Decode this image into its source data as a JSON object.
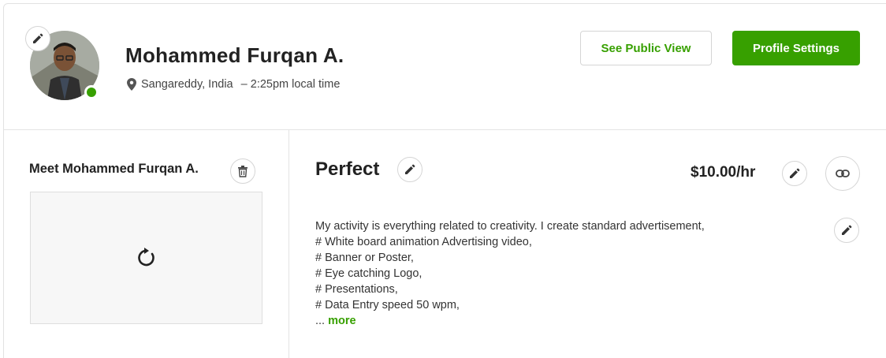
{
  "profile": {
    "name": "Mohammed Furqan A.",
    "location": "Sangareddy, India",
    "separator": " – ",
    "local_time": "2:25pm local time",
    "status": "online"
  },
  "actions": {
    "public_view_label": "See Public View",
    "settings_label": "Profile Settings"
  },
  "video": {
    "title": "Meet Mohammed Furqan A."
  },
  "overview": {
    "title": "Perfect",
    "rate": "$10.00/hr",
    "lines": [
      "My activity is everything related to creativity. I create standard advertisement,",
      "# White board animation Advertising video,",
      "# Banner or Poster,",
      "# Eye catching Logo,",
      "# Presentations,",
      "# Data Entry speed 50 wpm,"
    ],
    "ellipsis": "...",
    "more_label": "more"
  },
  "colors": {
    "accent": "#37a000",
    "border": "#e4e4e4"
  },
  "icons": [
    "pencil-icon",
    "location-pin-icon",
    "trash-icon",
    "reload-icon",
    "link-icon"
  ]
}
